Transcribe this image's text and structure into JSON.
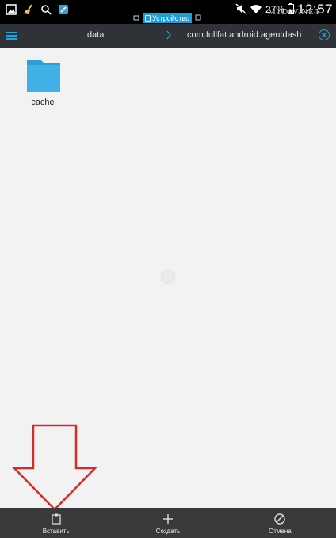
{
  "status_bar": {
    "storage_label": "Устройство",
    "battery": "27%",
    "time": "12:57",
    "watermark": "M1DIV.NET"
  },
  "toolbar": {
    "path": [
      "data",
      "com.fullfat.android.agentdash"
    ]
  },
  "files": [
    {
      "name": "cache",
      "type": "folder"
    }
  ],
  "bottom_bar": {
    "paste": "Вставить",
    "create": "Создать",
    "cancel": "Отмена"
  },
  "colors": {
    "accent": "#1fa3dd",
    "folder": "#3fb1e6",
    "arrow": "#d62a2a"
  }
}
